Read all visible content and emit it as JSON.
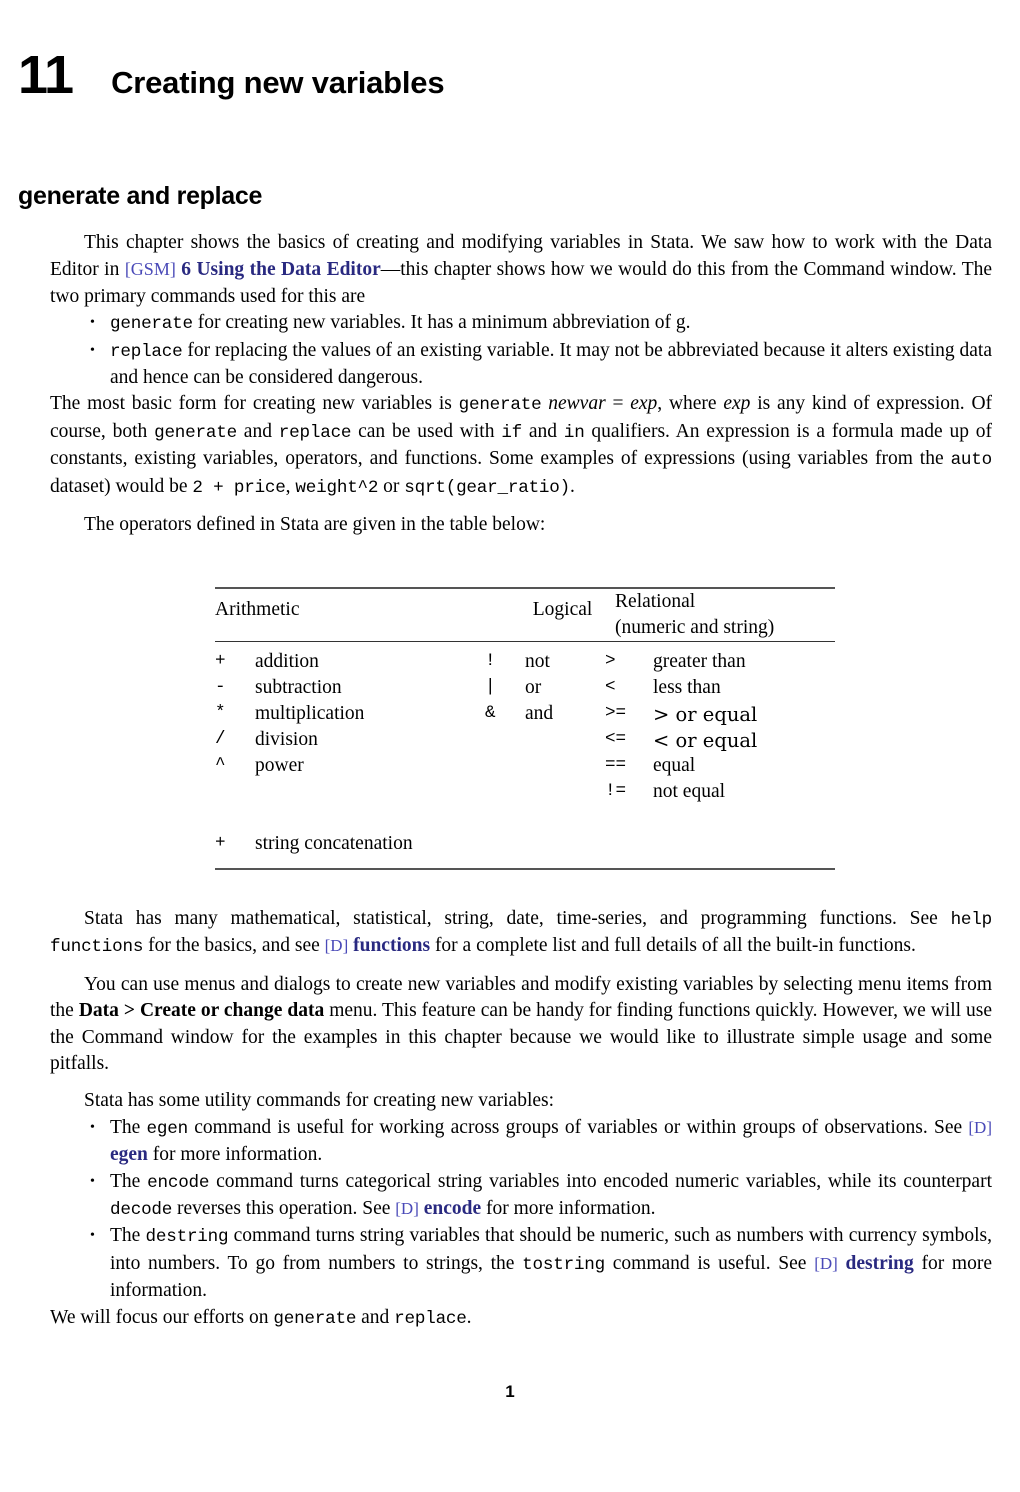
{
  "chapter": {
    "number": "11",
    "title": "Creating new variables"
  },
  "section": {
    "heading": "generate and replace"
  },
  "intro": {
    "p1_a": "This chapter shows the basics of creating and modifying variables in Stata. We saw how to work with the Data Editor in ",
    "p1_link_tag": "[GSM]",
    "p1_link_text": "6 Using the Data Editor",
    "p1_b": "—this chapter shows how we would do this from the Command window. The two primary commands used for this are"
  },
  "command_bullets": [
    {
      "bullet": "•",
      "code": "generate",
      "text": " for creating new variables. It has a minimum abbreviation of g."
    },
    {
      "bullet": "•",
      "code": "replace",
      "text": " for replacing the values of an existing variable. It may not be abbreviated because it alters existing data and hence can be considered dangerous."
    }
  ],
  "basic_form": {
    "a": "The most basic form for creating new variables is ",
    "code1": "generate",
    "b": " ",
    "it1": "newvar",
    "c": " = ",
    "it2": "exp",
    "d": ", where ",
    "it3": "exp",
    "e": " is any kind of expression. Of course, both ",
    "code2": "generate",
    "f": " and ",
    "code3": "replace",
    "g": " can be used with ",
    "code4": "if",
    "h": " and ",
    "code5": "in",
    "i": " qualifiers. An expression is a formula made up of constants, existing variables, operators, and functions. Some examples of expressions (using variables from the ",
    "code6": "auto",
    "j": " dataset) would be ",
    "code7": "2 + price",
    "k": ", ",
    "code8": "weight^2",
    "l": " or ",
    "code9": "sqrt(gear_ratio)",
    "m": "."
  },
  "table_lead": "The operators defined in Stata are given in the table below:",
  "operators_table": {
    "headers": {
      "arithmetic": "Arithmetic",
      "logical": "Logical",
      "relational_line1": "Relational",
      "relational_line2": "(numeric and string)"
    },
    "arithmetic": [
      {
        "symbol": "+",
        "desc": "addition"
      },
      {
        "symbol": "-",
        "desc": "subtraction"
      },
      {
        "symbol": "*",
        "desc": "multiplication"
      },
      {
        "symbol": "/",
        "desc": "division"
      },
      {
        "symbol": "^",
        "desc": "power"
      }
    ],
    "arithmetic_extra": {
      "symbol": "+",
      "desc": "string concatenation"
    },
    "logical": [
      {
        "symbol": "!",
        "desc": "not"
      },
      {
        "symbol": "|",
        "desc": "or"
      },
      {
        "symbol": "&",
        "desc": "and"
      }
    ],
    "relational": [
      {
        "symbol": ">",
        "desc": "greater than"
      },
      {
        "symbol": "<",
        "desc": "less than"
      },
      {
        "symbol": ">=",
        "desc": "> or equal"
      },
      {
        "symbol": "<=",
        "desc": "< or equal"
      },
      {
        "symbol": "==",
        "desc": "equal"
      },
      {
        "symbol": "!=",
        "desc": "not equal"
      }
    ]
  },
  "functions_para": {
    "a": "Stata has many mathematical, statistical, string, date, time-series, and programming functions. See ",
    "code1": "help functions",
    "b": " for the basics, and see ",
    "link_tag": "[D]",
    "link_text": "functions",
    "c": " for a complete list and full details of all the built-in functions."
  },
  "menus_para": {
    "a": "You can use menus and dialogs to create new variables and modify existing variables by selecting menu items from the ",
    "bold": "Data > Create or change data",
    "b": " menu. This feature can be handy for finding functions quickly. However, we will use the Command window for the examples in this chapter because we would like to illustrate simple usage and some pitfalls."
  },
  "utility_lead": "Stata has some utility commands for creating new variables:",
  "utility_bullets": [
    {
      "bullet": "•",
      "a": "The ",
      "code1": "egen",
      "b": " command is useful for working across groups of variables or within groups of observations. See ",
      "link_tag": "[D]",
      "link_text": "egen",
      "c": " for more information."
    },
    {
      "bullet": "•",
      "a": "The ",
      "code1": "encode",
      "b": " command turns categorical string variables into encoded numeric variables, while its counterpart ",
      "code2": "decode",
      "b2": " reverses this operation. See ",
      "link_tag": "[D]",
      "link_text": "encode",
      "c": " for more information."
    },
    {
      "bullet": "•",
      "a": "The ",
      "code1": "destring",
      "b": " command turns string variables that should be numeric, such as numbers with currency symbols, into numbers. To go from numbers to strings, the ",
      "code2": "tostring",
      "b2": " command is useful. See ",
      "link_tag": "[D]",
      "link_text": "destring",
      "c": " for more information."
    }
  ],
  "closing": {
    "a": "We will focus our efforts on ",
    "code1": "generate",
    "b": " and ",
    "code2": "replace",
    "c": "."
  },
  "page_number": "1"
}
